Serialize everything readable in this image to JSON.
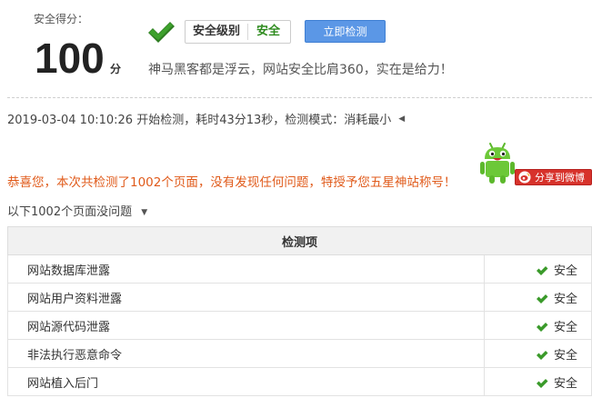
{
  "score": {
    "label": "安全得分：",
    "value": "100",
    "unit": "分"
  },
  "security_level": {
    "label": "安全级别",
    "value": "安全"
  },
  "actions": {
    "scan_now": "立即检测",
    "share_weibo": "分享到微博"
  },
  "slogan": "神马黑客都是浮云，网站安全比肩360，实在是给力！",
  "scan_info": "2019-03-04 10:10:26 开始检测，耗时43分13秒，检测模式：消耗最小",
  "congrats": "恭喜您，本次共检测了1002个页面，没有发现任何问题，特授予您五星神站称号！",
  "filter_label": "以下1002个页面没问题",
  "table": {
    "header": "检测项",
    "rows": [
      {
        "item": "网站数据库泄露",
        "status": "安全"
      },
      {
        "item": "网站用户资料泄露",
        "status": "安全"
      },
      {
        "item": "网站源代码泄露",
        "status": "安全"
      },
      {
        "item": "非法执行恶意命令",
        "status": "安全"
      },
      {
        "item": "网站植入后门",
        "status": "安全"
      }
    ]
  },
  "colors": {
    "safe_green": "#2e8b1e",
    "check_green": "#3a9a2a",
    "congrats_orange": "#e05a1a",
    "button_blue": "#5b97e6",
    "weibo_red": "#d7322b"
  },
  "icons": {
    "big_check": "check-icon",
    "row_check": "check-icon",
    "mascot": "android-mascot-icon",
    "weibo": "weibo-icon",
    "caret_left": "caret-left-icon",
    "caret_down": "caret-down-icon"
  }
}
